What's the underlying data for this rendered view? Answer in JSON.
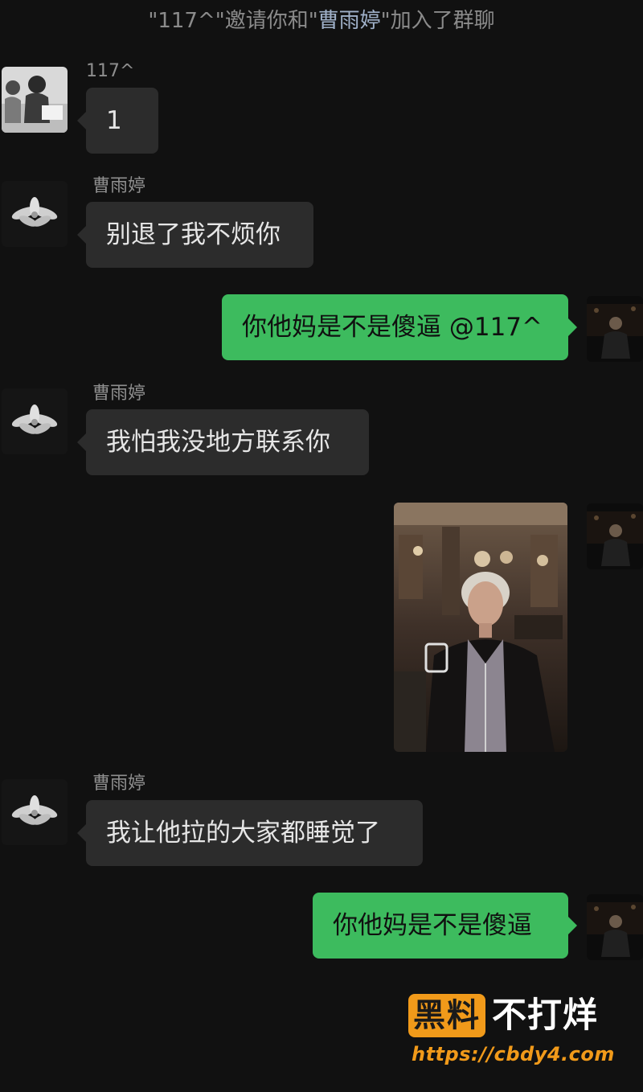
{
  "system_message": {
    "part1": "\"117^\"邀请你和\"",
    "name": "曹雨婷",
    "part2": "\"加入了群聊"
  },
  "messages": [
    {
      "sender": "117^",
      "text": "1",
      "direction": "received"
    },
    {
      "sender": "曹雨婷",
      "text": "别退了我不烦你",
      "direction": "received"
    },
    {
      "text": "你他妈是不是傻逼 @117^",
      "direction": "sent"
    },
    {
      "sender": "曹雨婷",
      "text": "我怕我没地方联系你",
      "direction": "received"
    },
    {
      "type": "image",
      "direction": "sent"
    },
    {
      "sender": "曹雨婷",
      "text": "我让他拉的大家都睡觉了",
      "direction": "received"
    },
    {
      "text": "你他妈是不是傻逼",
      "direction": "sent"
    }
  ],
  "watermark": {
    "box": "黑料",
    "side": "不打烊",
    "url": "https://cbdy4.com"
  },
  "colors": {
    "background": "#111111",
    "sent_bubble": "#3dbb5e",
    "received_bubble": "#2c2c2c",
    "watermark_accent": "#f19a1a"
  }
}
